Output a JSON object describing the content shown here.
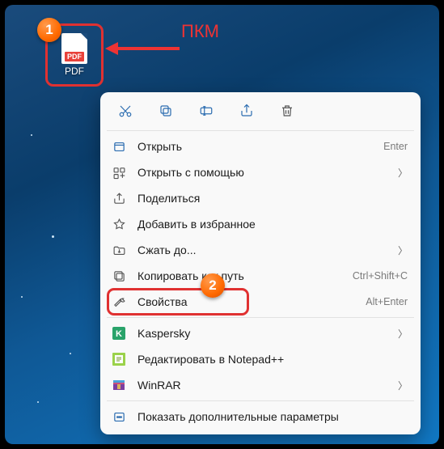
{
  "annotation": {
    "pkm": "ПКМ",
    "step1": "1",
    "step2": "2"
  },
  "desktop": {
    "pdf_badge": "PDF",
    "pdf_label": "PDF"
  },
  "menu": {
    "open": "Открыть",
    "open_key": "Enter",
    "open_with": "Открыть с помощью",
    "share": "Поделиться",
    "favorite": "Добавить в избранное",
    "compress": "Сжать до...",
    "copy_path": "Копировать как путь",
    "copy_path_key": "Ctrl+Shift+C",
    "properties": "Свойства",
    "properties_key": "Alt+Enter",
    "kaspersky": "Kaspersky",
    "notepadpp": "Редактировать в Notepad++",
    "winrar": "WinRAR",
    "more": "Показать дополнительные параметры"
  }
}
